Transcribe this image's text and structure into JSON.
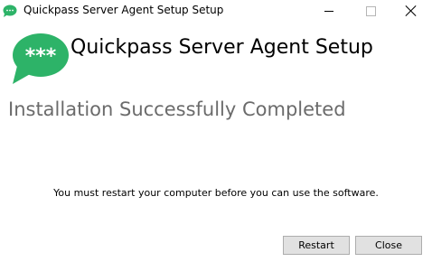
{
  "window": {
    "title": "Quickpass Server Agent Setup Setup",
    "controls": {
      "minimize_icon": "minimize-icon",
      "maximize_icon": "maximize-icon",
      "close_icon": "close-icon"
    }
  },
  "header": {
    "logo_icon": "chat-bubble-asterisks-icon",
    "logo_text": "***",
    "product_title": "Quickpass Server Agent Setup"
  },
  "main": {
    "status_heading": "Installation Successfully Completed",
    "message": "You must restart your computer before you can use the software."
  },
  "buttons": {
    "restart_label": "Restart",
    "close_label": "Close"
  },
  "colors": {
    "brand_green": "#2db368",
    "heading_gray": "#6b6b6b",
    "button_face": "#e1e1e1",
    "button_border": "#adadad"
  }
}
